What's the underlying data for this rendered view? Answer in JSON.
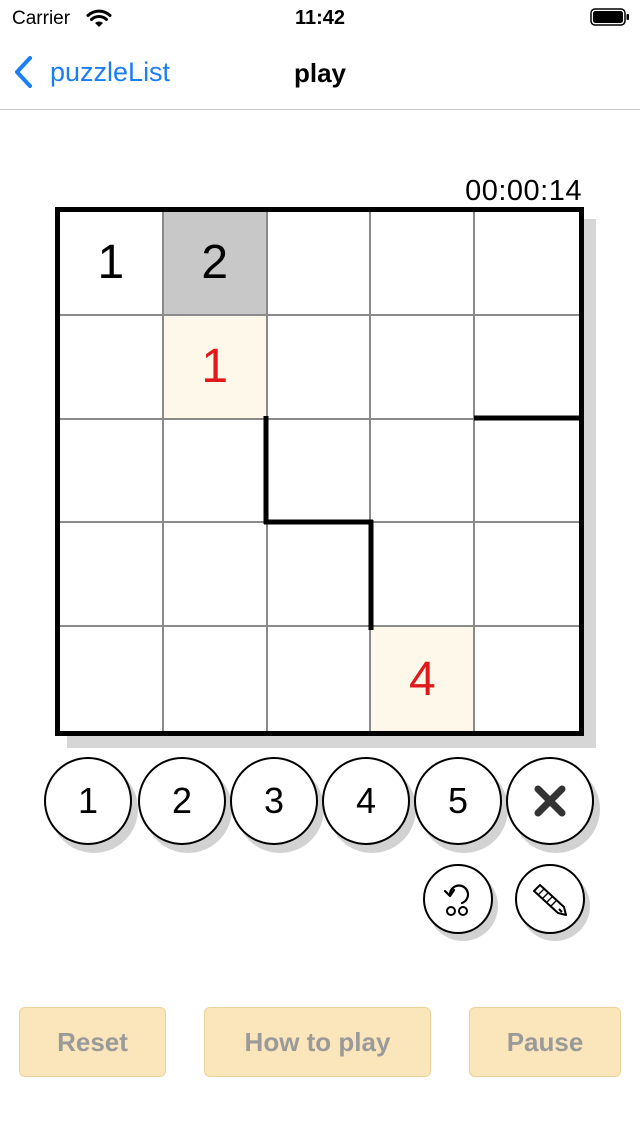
{
  "status_bar": {
    "carrier": "Carrier",
    "time": "11:42",
    "icons": [
      "wifi-icon",
      "battery-icon"
    ]
  },
  "nav": {
    "back_label": "puzzleList",
    "title": "play",
    "back_icon": "chevron-left-icon",
    "accent_color": "#1a7ef5"
  },
  "timer": "00:00:14",
  "board": {
    "size": 5,
    "rows": [
      [
        {
          "v": "1",
          "state": "given"
        },
        {
          "v": "2",
          "state": "selected"
        },
        {
          "v": "",
          "state": ""
        },
        {
          "v": "",
          "state": ""
        },
        {
          "v": "",
          "state": ""
        }
      ],
      [
        {
          "v": "",
          "state": ""
        },
        {
          "v": "1",
          "state": "hint"
        },
        {
          "v": "",
          "state": ""
        },
        {
          "v": "",
          "state": ""
        },
        {
          "v": "",
          "state": ""
        }
      ],
      [
        {
          "v": "",
          "state": ""
        },
        {
          "v": "",
          "state": ""
        },
        {
          "v": "",
          "state": ""
        },
        {
          "v": "",
          "state": ""
        },
        {
          "v": "",
          "state": ""
        }
      ],
      [
        {
          "v": "",
          "state": ""
        },
        {
          "v": "",
          "state": ""
        },
        {
          "v": "",
          "state": ""
        },
        {
          "v": "",
          "state": ""
        },
        {
          "v": "",
          "state": ""
        }
      ],
      [
        {
          "v": "",
          "state": ""
        },
        {
          "v": "",
          "state": ""
        },
        {
          "v": "",
          "state": ""
        },
        {
          "v": "4",
          "state": "hint"
        },
        {
          "v": "",
          "state": ""
        }
      ]
    ],
    "colors": {
      "hint_text": "#e0191b",
      "hint_bg": "#fdf8ea",
      "selected_bg": "#c8c8c8"
    }
  },
  "number_buttons": [
    "1",
    "2",
    "3",
    "4",
    "5"
  ],
  "clear_icon": "close-icon",
  "tools": [
    "undo-icon",
    "pencil-icon"
  ],
  "bottom_buttons": {
    "reset": "Reset",
    "how_to_play": "How to play",
    "pause": "Pause",
    "bg_color": "#fbe6bb"
  }
}
